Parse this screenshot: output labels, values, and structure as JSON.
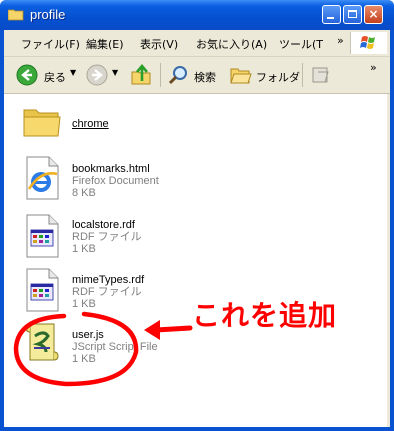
{
  "window": {
    "title": "profile"
  },
  "titlebar_buttons": {
    "minimize": "",
    "maximize": "",
    "close": "×"
  },
  "menu": {
    "items": [
      "ファイル(F)",
      "編集(E)",
      "表示(V)",
      "お気に入り(A)",
      "ツール(T"
    ],
    "overflow": "»"
  },
  "toolbar": {
    "back_label": "戻る",
    "search_label": "検索",
    "folders_label": "フォルダ",
    "overflow": "»"
  },
  "files": [
    {
      "name": "chrome",
      "type": "",
      "size": "",
      "icon": "folder-icon"
    },
    {
      "name": "bookmarks.html",
      "type": "Firefox Document",
      "size": "8 KB",
      "icon": "ie-document-icon"
    },
    {
      "name": "localstore.rdf",
      "type": "RDF ファイル",
      "size": "1 KB",
      "icon": "rdf-file-icon"
    },
    {
      "name": "mimeTypes.rdf",
      "type": "RDF ファイル",
      "size": "1 KB",
      "icon": "rdf-file-icon"
    },
    {
      "name": "user.js",
      "type": "JScript Script File",
      "size": "1 KB",
      "icon": "script-file-icon"
    }
  ],
  "annotation": {
    "text": "これを追加",
    "color": "#ff0000"
  },
  "colors": {
    "titlebar": "#0550d0",
    "chrome": "#ece9d8",
    "annotation": "#ff0000"
  }
}
